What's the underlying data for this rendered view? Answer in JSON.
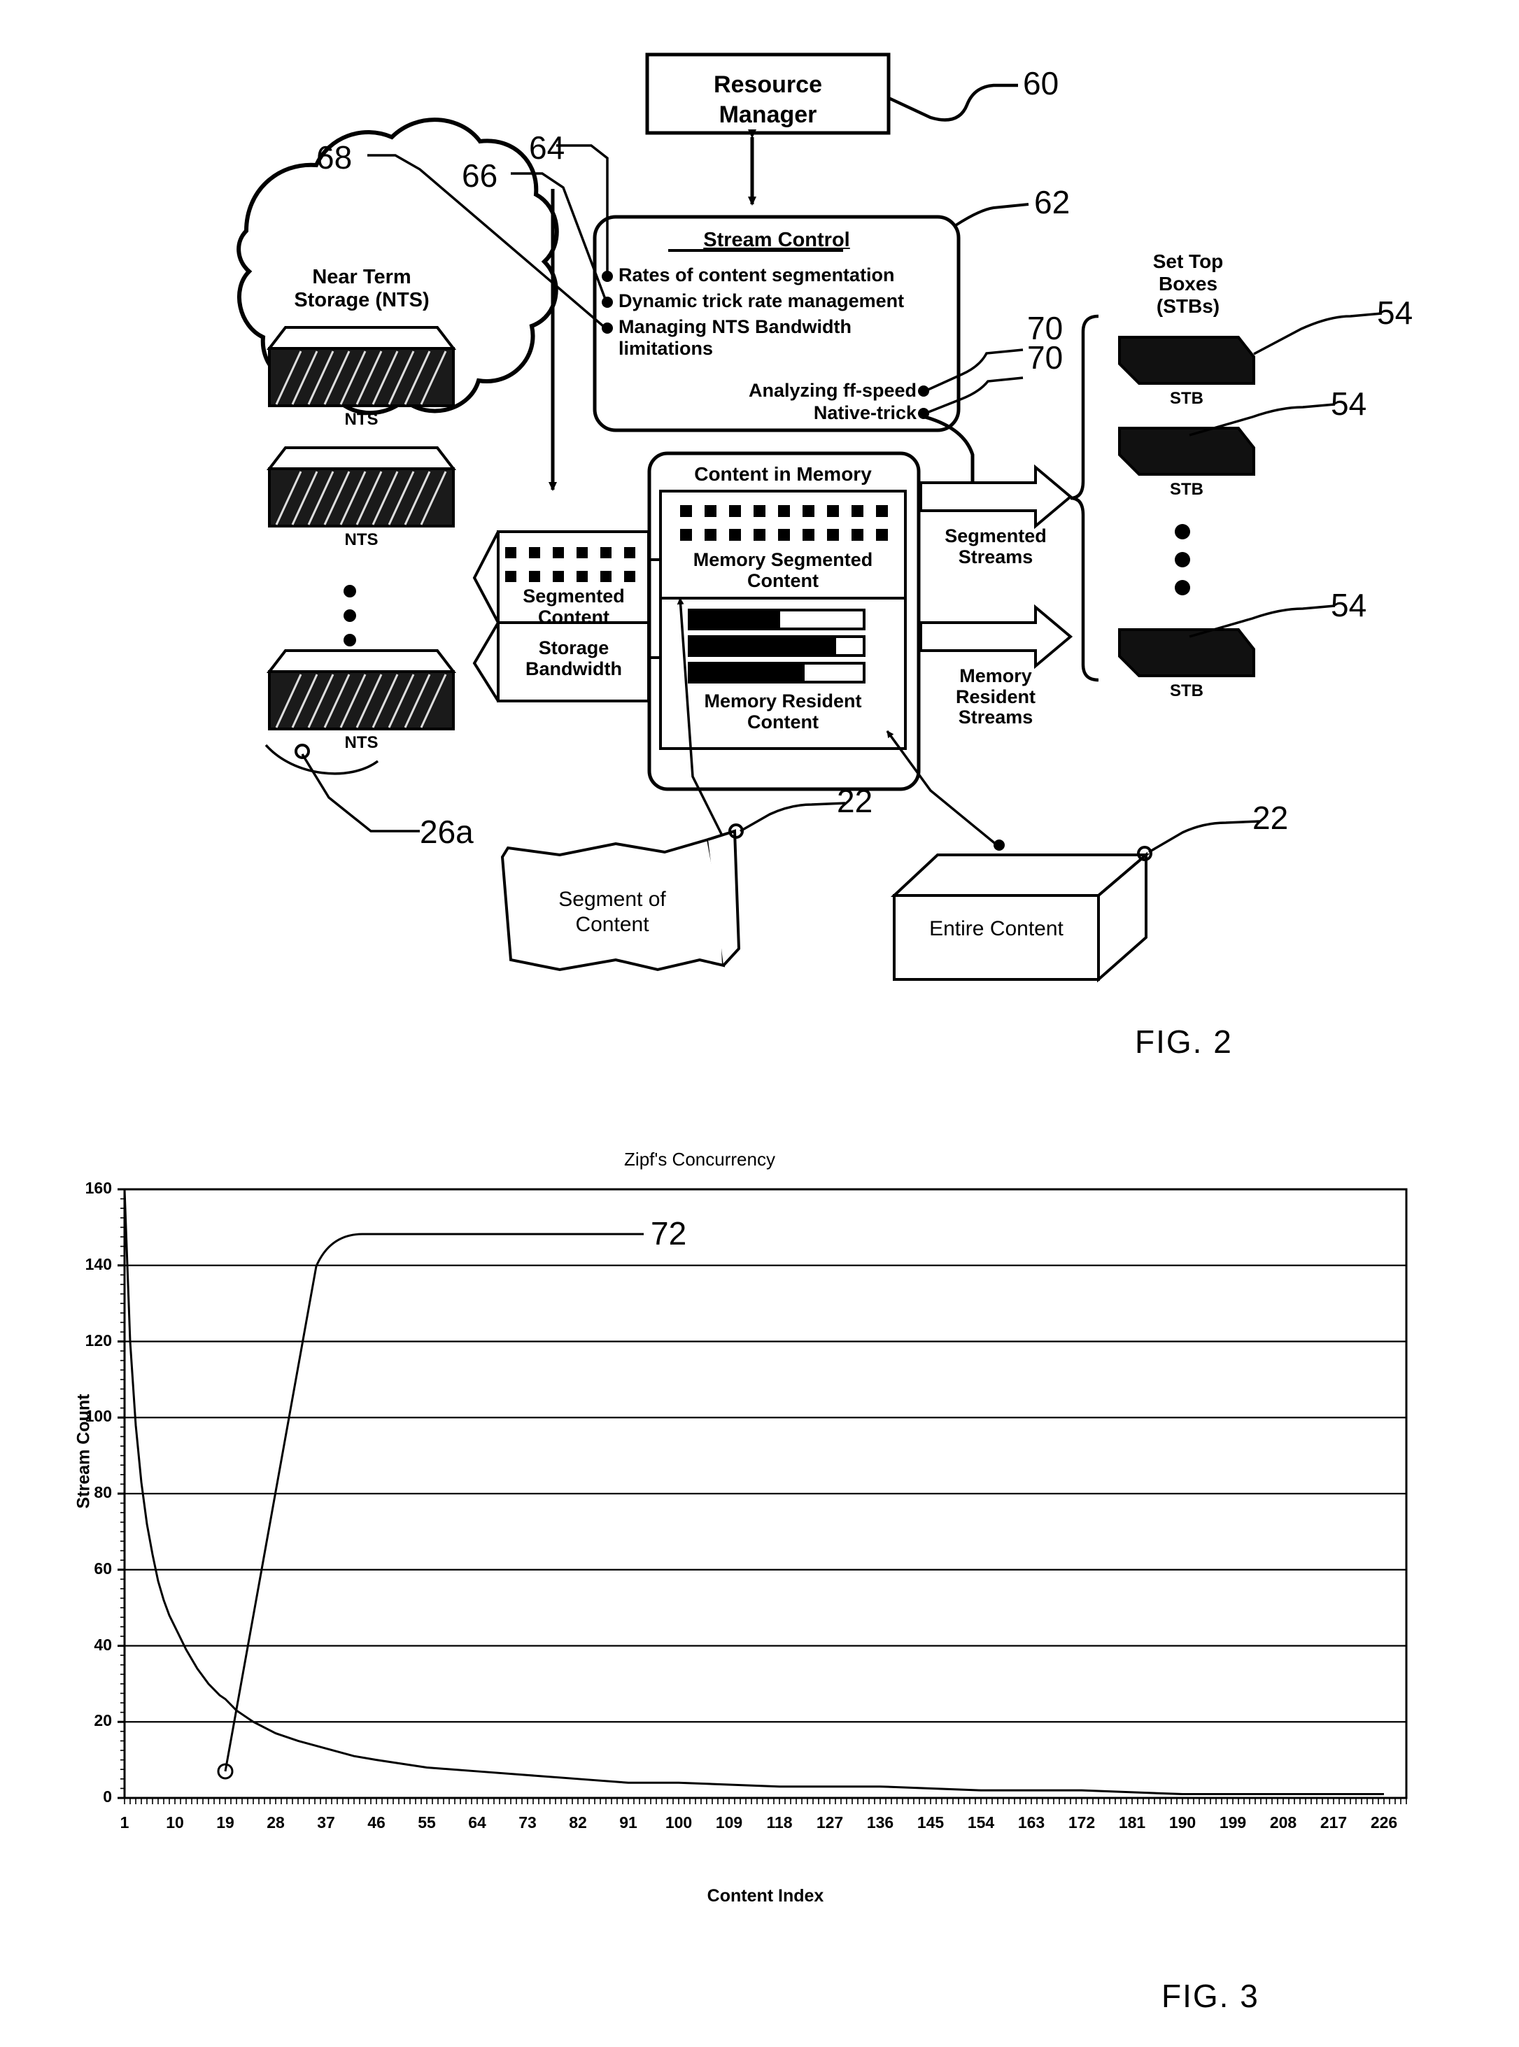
{
  "figure2": {
    "resource_manager": {
      "line1": "Resource",
      "line2": "Manager",
      "ref": "60"
    },
    "stream_control": {
      "title": "Stream Control",
      "ref": "62",
      "bullets": [
        "Rates of content segmentation",
        "Dynamic trick rate management",
        "Managing NTS Bandwidth limitations"
      ],
      "right_bullets": [
        "Analyzing ff-speed",
        "Native-trick"
      ],
      "bullet_refs": [
        "64",
        "66",
        "68"
      ],
      "right_refs": [
        "70",
        "70"
      ]
    },
    "nts_cloud": {
      "title_line1": "Near Term",
      "title_line2": "Storage (NTS)",
      "device_label": "NTS",
      "devices": [
        "NTS",
        "NTS",
        "NTS"
      ],
      "ref": "26a"
    },
    "bandwidth_band": {
      "segmented_content": "Segmented Content",
      "storage_bandwidth": "Storage Bandwidth"
    },
    "content_in_memory": {
      "title": "Content in Memory",
      "segmented_caption_line1": "Memory Segmented",
      "segmented_caption_line2": "Content",
      "resident_caption_line1": "Memory Resident",
      "resident_caption_line2": "Content",
      "segment_grid_cols": 9,
      "segment_grid_rows": 2,
      "resident_bars": [
        52,
        84,
        66
      ]
    },
    "streams": {
      "segmented_line1": "Segmented",
      "segmented_line2": "Streams",
      "resident_line1": "Memory",
      "resident_line2": "Resident",
      "resident_line3": "Streams"
    },
    "stb_group": {
      "title_line1": "Set Top",
      "title_line2": "Boxes",
      "title_line3": "(STBs)",
      "item_label": "STB",
      "refs": [
        "54",
        "54",
        "54"
      ]
    },
    "content_objects": [
      {
        "line1": "Segment of",
        "line2": "Content",
        "ref": "22"
      },
      {
        "line1": "Entire Content",
        "line2": "",
        "ref": "22"
      }
    ],
    "fig_label": "FIG.  2"
  },
  "figure3": {
    "fig_label": "FIG.  3",
    "annotation_ref": "72",
    "chart_data": {
      "type": "line",
      "title": "Zipf's Concurrency",
      "xlabel": "Content Index",
      "ylabel": "Stream Count",
      "xlim": [
        1,
        230
      ],
      "ylim": [
        0,
        160
      ],
      "y_ticks": [
        0,
        20,
        40,
        60,
        80,
        100,
        120,
        140,
        160
      ],
      "x_ticks": [
        1,
        10,
        19,
        28,
        37,
        46,
        55,
        64,
        73,
        82,
        91,
        100,
        109,
        118,
        127,
        136,
        145,
        154,
        163,
        172,
        181,
        190,
        199,
        208,
        217,
        226
      ],
      "grid": true,
      "legend": false,
      "series": [
        {
          "name": "Zipf concurrency",
          "x": [
            1,
            2,
            3,
            4,
            5,
            6,
            7,
            8,
            9,
            10,
            12,
            14,
            16,
            18,
            19,
            21,
            24,
            28,
            32,
            37,
            42,
            46,
            55,
            64,
            73,
            82,
            91,
            100,
            118,
            136,
            154,
            172,
            190,
            208,
            226
          ],
          "values": [
            160,
            120,
            98,
            83,
            72,
            64,
            57,
            52,
            48,
            45,
            39,
            34,
            30,
            27,
            26,
            23,
            20,
            17,
            15,
            13,
            11,
            10,
            8,
            7,
            6,
            5,
            4,
            4,
            3,
            3,
            2,
            2,
            1,
            1,
            1
          ]
        }
      ],
      "annotation": {
        "label": "72",
        "points_to_x": 19,
        "points_to_y": 7
      }
    }
  }
}
